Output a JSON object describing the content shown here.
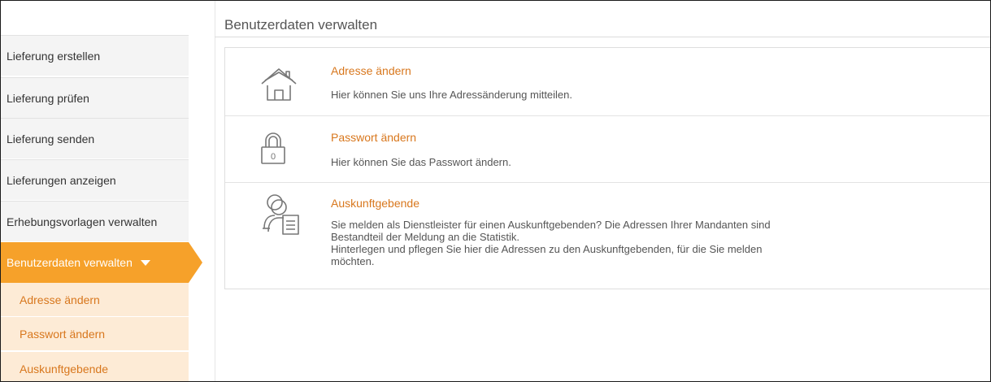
{
  "page": {
    "title": "Benutzerdaten verwalten"
  },
  "sidebar": {
    "items": [
      {
        "label": "Lieferung erstellen"
      },
      {
        "label": "Lieferung prüfen"
      },
      {
        "label": "Lieferung senden"
      },
      {
        "label": "Lieferungen anzeigen"
      },
      {
        "label": "Erhebungsvorlagen verwalten"
      },
      {
        "label": "Benutzerdaten verwalten",
        "active": true,
        "icon": "chevron-down-icon"
      }
    ],
    "subitems": [
      {
        "label": "Adresse ändern"
      },
      {
        "label": "Passwort ändern"
      },
      {
        "label": "Auskunftgebende"
      }
    ]
  },
  "cards": [
    {
      "icon": "house-icon",
      "title": "Adresse ändern",
      "description": "Hier können Sie uns Ihre Adressänderung mitteilen."
    },
    {
      "icon": "padlock-icon",
      "title": "Passwort ändern",
      "description": "Hier können Sie das Passwort ändern."
    },
    {
      "icon": "users-document-icon",
      "title": "Auskunftgebende",
      "description_lines": [
        "Sie melden als Dienstleister für einen Auskunftgebenden? Die Adressen Ihrer Mandanten sind",
        "Bestandteil der Meldung an die Statistik.",
        "Hinterlegen und pflegen Sie hier die Adressen zu den Auskunftgebenden, für die Sie melden",
        "möchten."
      ]
    }
  ],
  "colors": {
    "accent": "#f6a12a",
    "link": "#d8771d",
    "submenu_bg": "#fdebd6"
  }
}
